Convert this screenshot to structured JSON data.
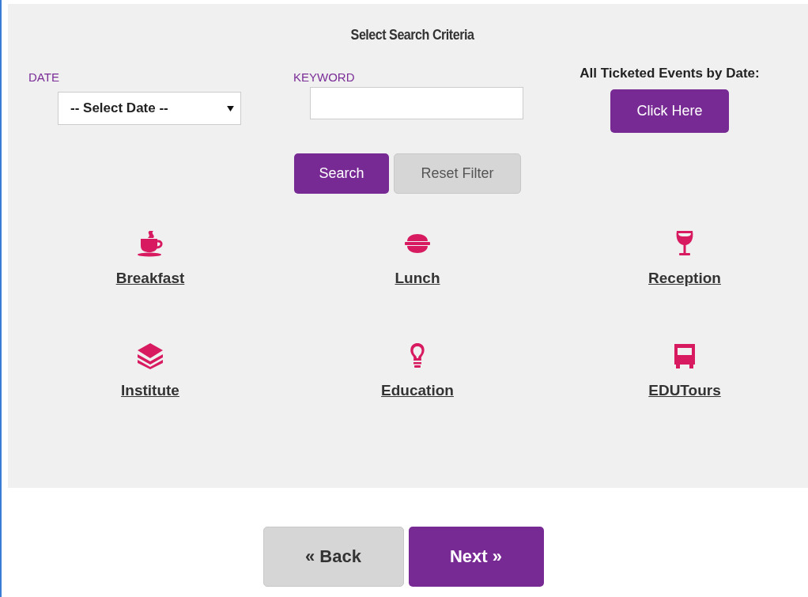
{
  "title": "Select Search Criteria",
  "date": {
    "label": "DATE",
    "value": "-- Select Date --"
  },
  "keyword": {
    "label": "KEYWORD"
  },
  "ticketed": {
    "label": "All Ticketed Events by Date:",
    "button": "Click Here"
  },
  "actions": [
    "Search",
    "Reset Filter"
  ],
  "categories": [
    {
      "label": "Breakfast",
      "kind": "cup"
    },
    {
      "label": "Lunch",
      "kind": "burger"
    },
    {
      "label": "Reception",
      "kind": "wine"
    },
    {
      "label": "Institute",
      "kind": "books"
    },
    {
      "label": "Education",
      "kind": "bulb"
    },
    {
      "label": "EDUTours",
      "kind": "bus"
    }
  ],
  "nav": {
    "back": "« Back",
    "next": "Next »"
  }
}
